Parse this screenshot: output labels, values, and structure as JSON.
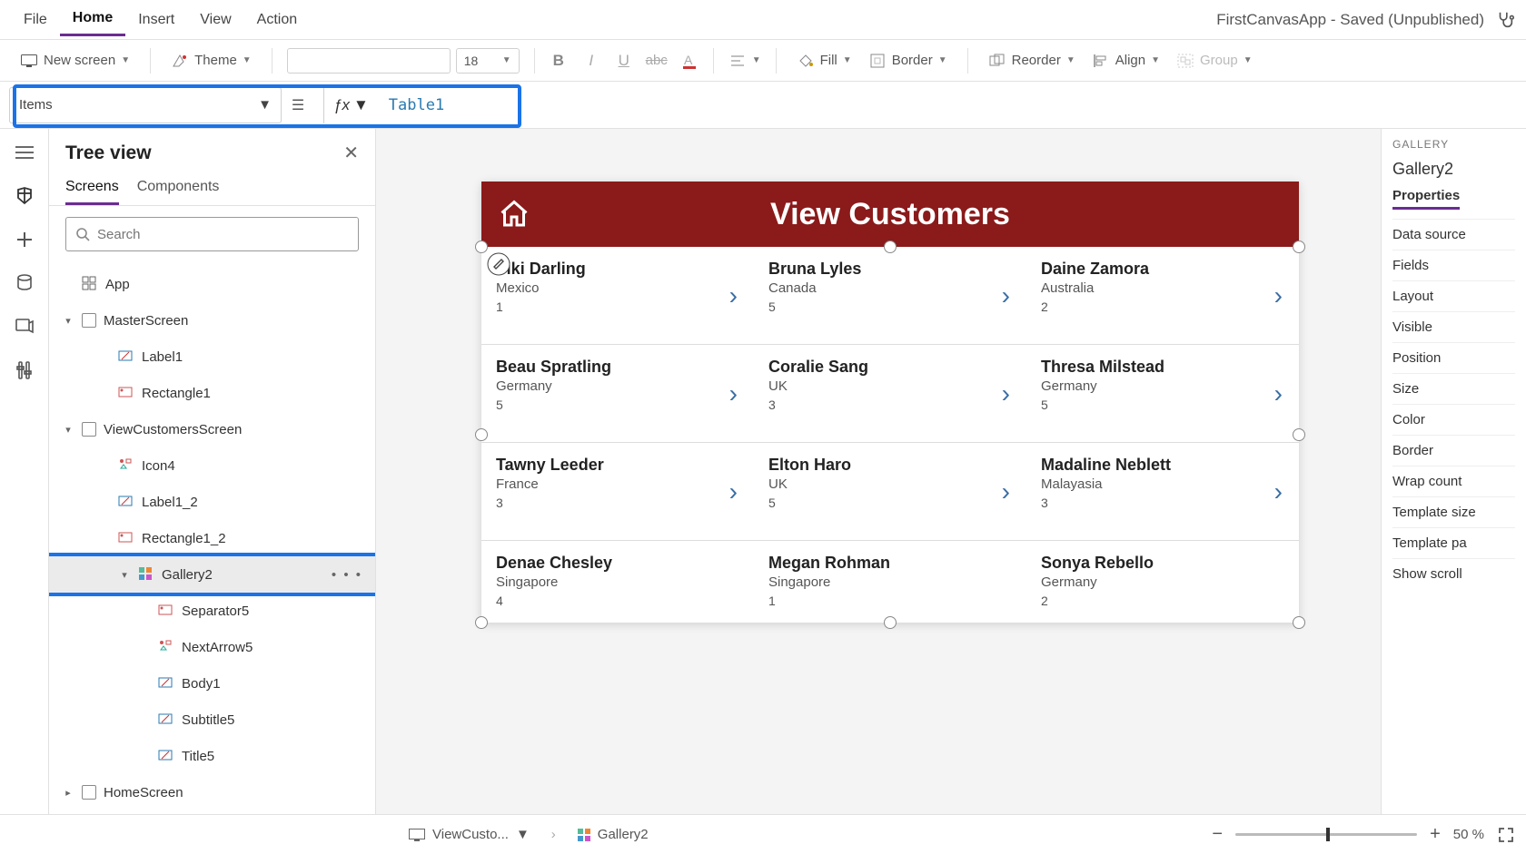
{
  "menu": {
    "file": "File",
    "home": "Home",
    "insert": "Insert",
    "view": "View",
    "action": "Action",
    "app_title": "FirstCanvasApp - Saved (Unpublished)"
  },
  "ribbon": {
    "new_screen": "New screen",
    "theme": "Theme",
    "font_size": "18",
    "fill": "Fill",
    "border": "Border",
    "reorder": "Reorder",
    "align": "Align",
    "group": "Group"
  },
  "formula": {
    "property": "Items",
    "value": "Table1"
  },
  "tree": {
    "title": "Tree view",
    "tabs": {
      "screens": "Screens",
      "components": "Components"
    },
    "search_placeholder": "Search",
    "nodes": {
      "app": "App",
      "master": "MasterScreen",
      "label1": "Label1",
      "rect1": "Rectangle1",
      "viewcust": "ViewCustomersScreen",
      "icon4": "Icon4",
      "label1_2": "Label1_2",
      "rect1_2": "Rectangle1_2",
      "gallery2": "Gallery2",
      "separator5": "Separator5",
      "nextarrow5": "NextArrow5",
      "body1": "Body1",
      "subtitle5": "Subtitle5",
      "title5": "Title5",
      "homescreen": "HomeScreen"
    }
  },
  "canvas": {
    "header_title": "View Customers",
    "customers": [
      {
        "name": "Viki  Darling",
        "country": "Mexico",
        "num": "1"
      },
      {
        "name": "Bruna  Lyles",
        "country": "Canada",
        "num": "5"
      },
      {
        "name": "Daine  Zamora",
        "country": "Australia",
        "num": "2"
      },
      {
        "name": "Beau  Spratling",
        "country": "Germany",
        "num": "5"
      },
      {
        "name": "Coralie  Sang",
        "country": "UK",
        "num": "3"
      },
      {
        "name": "Thresa  Milstead",
        "country": "Germany",
        "num": "5"
      },
      {
        "name": "Tawny  Leeder",
        "country": "France",
        "num": "3"
      },
      {
        "name": "Elton  Haro",
        "country": "UK",
        "num": "5"
      },
      {
        "name": "Madaline  Neblett",
        "country": "Malayasia",
        "num": "3"
      },
      {
        "name": "Denae  Chesley",
        "country": "Singapore",
        "num": "4"
      },
      {
        "name": "Megan  Rohman",
        "country": "Singapore",
        "num": "1"
      },
      {
        "name": "Sonya  Rebello",
        "country": "Germany",
        "num": "2"
      }
    ]
  },
  "props": {
    "eyebrow": "GALLERY",
    "name": "Gallery2",
    "tab": "Properties",
    "rows": [
      "Data source",
      "Fields",
      "Layout",
      "Visible",
      "Position",
      "Size",
      "Color",
      "Border",
      "Wrap count",
      "Template size",
      "Template pa",
      "Show scroll"
    ]
  },
  "status": {
    "crumb1": "ViewCusto...",
    "crumb2": "Gallery2",
    "zoom": "50  %"
  }
}
